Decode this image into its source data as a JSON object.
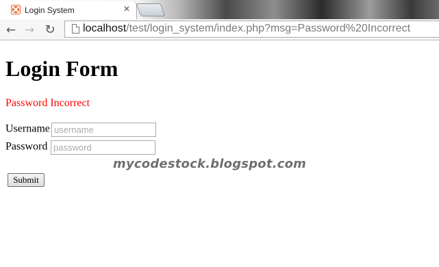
{
  "browser": {
    "tab_title": "Login System",
    "tab_close_icon": "close-icon",
    "favicon_icon": "xampp-icon",
    "url_host": "localhost",
    "url_path": "/test/login_system/index.php?msg=Password%20Incorrect"
  },
  "page": {
    "heading": "Login Form",
    "error_message": "Password Incorrect",
    "error_color": "#ff0000",
    "username_label": "Username",
    "username_placeholder": "username",
    "username_value": "",
    "password_label": "Password",
    "password_placeholder": "password",
    "password_value": "",
    "submit_label": "Submit"
  },
  "watermark": "mycodestock.blogspot.com"
}
